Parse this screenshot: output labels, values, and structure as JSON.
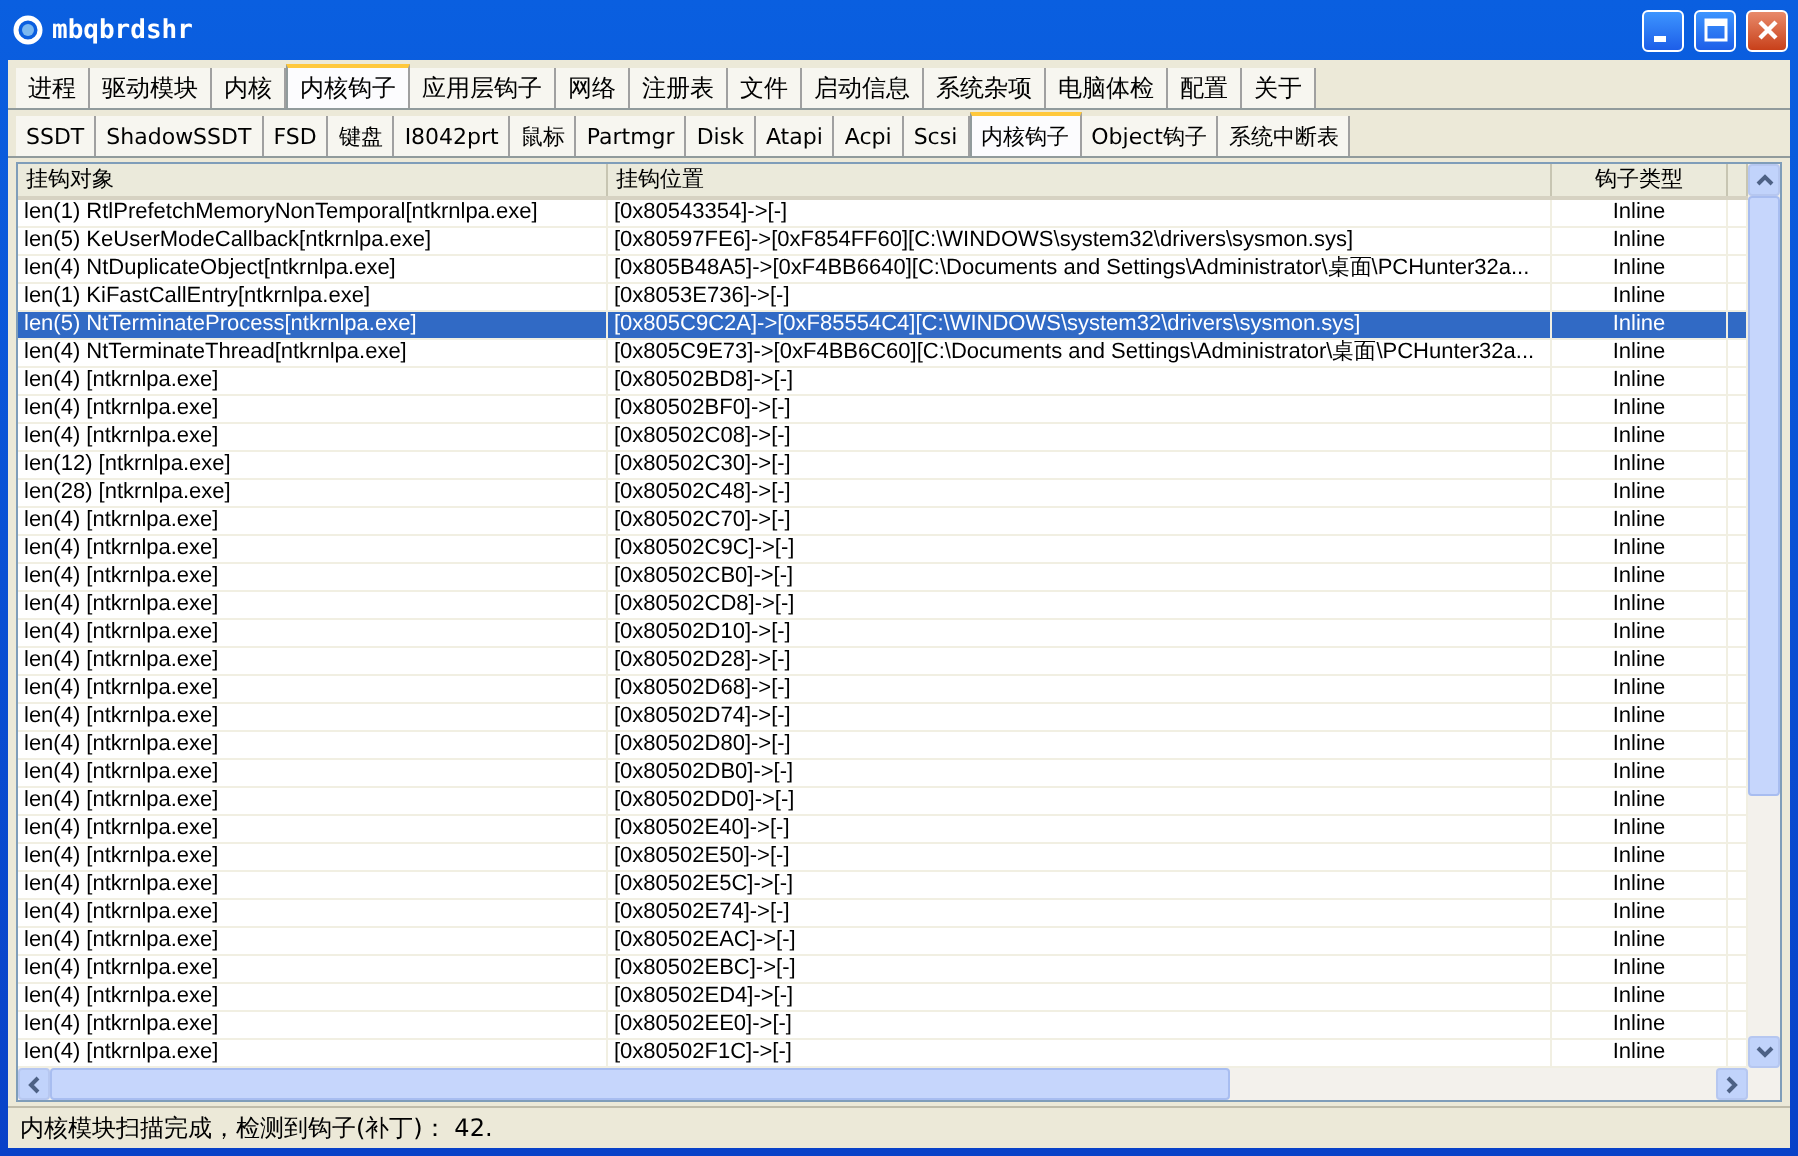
{
  "window": {
    "title": "mbqbrdshr"
  },
  "main_tabs": [
    {
      "label": "进程",
      "selected": false
    },
    {
      "label": "驱动模块",
      "selected": false
    },
    {
      "label": "内核",
      "selected": false
    },
    {
      "label": "内核钩子",
      "selected": true
    },
    {
      "label": "应用层钩子",
      "selected": false
    },
    {
      "label": "网络",
      "selected": false
    },
    {
      "label": "注册表",
      "selected": false
    },
    {
      "label": "文件",
      "selected": false
    },
    {
      "label": "启动信息",
      "selected": false
    },
    {
      "label": "系统杂项",
      "selected": false
    },
    {
      "label": "电脑体检",
      "selected": false
    },
    {
      "label": "配置",
      "selected": false
    },
    {
      "label": "关于",
      "selected": false
    }
  ],
  "sub_tabs": [
    {
      "label": "SSDT",
      "selected": false
    },
    {
      "label": "ShadowSSDT",
      "selected": false
    },
    {
      "label": "FSD",
      "selected": false
    },
    {
      "label": "键盘",
      "selected": false
    },
    {
      "label": "I8042prt",
      "selected": false
    },
    {
      "label": "鼠标",
      "selected": false
    },
    {
      "label": "Partmgr",
      "selected": false
    },
    {
      "label": "Disk",
      "selected": false
    },
    {
      "label": "Atapi",
      "selected": false
    },
    {
      "label": "Acpi",
      "selected": false
    },
    {
      "label": "Scsi",
      "selected": false
    },
    {
      "label": "内核钩子",
      "selected": true
    },
    {
      "label": "Object钩子",
      "selected": false
    },
    {
      "label": "系统中断表",
      "selected": false
    }
  ],
  "table": {
    "columns": [
      "挂钩对象",
      "挂钩位置",
      "钩子类型"
    ],
    "rows": [
      {
        "object": "len(1) RtlPrefetchMemoryNonTemporal[ntkrnlpa.exe]",
        "location": "[0x80543354]->[-]",
        "type": "Inline",
        "selected": false
      },
      {
        "object": "len(5) KeUserModeCallback[ntkrnlpa.exe]",
        "location": "[0x80597FE6]->[0xF854FF60][C:\\WINDOWS\\system32\\drivers\\sysmon.sys]",
        "type": "Inline",
        "selected": false
      },
      {
        "object": "len(4) NtDuplicateObject[ntkrnlpa.exe]",
        "location": "[0x805B48A5]->[0xF4BB6640][C:\\Documents and Settings\\Administrator\\桌面\\PCHunter32a...",
        "type": "Inline",
        "selected": false
      },
      {
        "object": "len(1) KiFastCallEntry[ntkrnlpa.exe]",
        "location": "[0x8053E736]->[-]",
        "type": "Inline",
        "selected": false
      },
      {
        "object": "len(5) NtTerminateProcess[ntkrnlpa.exe]",
        "location": "[0x805C9C2A]->[0xF85554C4][C:\\WINDOWS\\system32\\drivers\\sysmon.sys]",
        "type": "Inline",
        "selected": true
      },
      {
        "object": "len(4) NtTerminateThread[ntkrnlpa.exe]",
        "location": "[0x805C9E73]->[0xF4BB6C60][C:\\Documents and Settings\\Administrator\\桌面\\PCHunter32a...",
        "type": "Inline",
        "selected": false
      },
      {
        "object": "len(4) [ntkrnlpa.exe]",
        "location": "[0x80502BD8]->[-]",
        "type": "Inline",
        "selected": false
      },
      {
        "object": "len(4) [ntkrnlpa.exe]",
        "location": "[0x80502BF0]->[-]",
        "type": "Inline",
        "selected": false
      },
      {
        "object": "len(4) [ntkrnlpa.exe]",
        "location": "[0x80502C08]->[-]",
        "type": "Inline",
        "selected": false
      },
      {
        "object": "len(12) [ntkrnlpa.exe]",
        "location": "[0x80502C30]->[-]",
        "type": "Inline",
        "selected": false
      },
      {
        "object": "len(28) [ntkrnlpa.exe]",
        "location": "[0x80502C48]->[-]",
        "type": "Inline",
        "selected": false
      },
      {
        "object": "len(4) [ntkrnlpa.exe]",
        "location": "[0x80502C70]->[-]",
        "type": "Inline",
        "selected": false
      },
      {
        "object": "len(4) [ntkrnlpa.exe]",
        "location": "[0x80502C9C]->[-]",
        "type": "Inline",
        "selected": false
      },
      {
        "object": "len(4) [ntkrnlpa.exe]",
        "location": "[0x80502CB0]->[-]",
        "type": "Inline",
        "selected": false
      },
      {
        "object": "len(4) [ntkrnlpa.exe]",
        "location": "[0x80502CD8]->[-]",
        "type": "Inline",
        "selected": false
      },
      {
        "object": "len(4) [ntkrnlpa.exe]",
        "location": "[0x80502D10]->[-]",
        "type": "Inline",
        "selected": false
      },
      {
        "object": "len(4) [ntkrnlpa.exe]",
        "location": "[0x80502D28]->[-]",
        "type": "Inline",
        "selected": false
      },
      {
        "object": "len(4) [ntkrnlpa.exe]",
        "location": "[0x80502D68]->[-]",
        "type": "Inline",
        "selected": false
      },
      {
        "object": "len(4) [ntkrnlpa.exe]",
        "location": "[0x80502D74]->[-]",
        "type": "Inline",
        "selected": false
      },
      {
        "object": "len(4) [ntkrnlpa.exe]",
        "location": "[0x80502D80]->[-]",
        "type": "Inline",
        "selected": false
      },
      {
        "object": "len(4) [ntkrnlpa.exe]",
        "location": "[0x80502DB0]->[-]",
        "type": "Inline",
        "selected": false
      },
      {
        "object": "len(4) [ntkrnlpa.exe]",
        "location": "[0x80502DD0]->[-]",
        "type": "Inline",
        "selected": false
      },
      {
        "object": "len(4) [ntkrnlpa.exe]",
        "location": "[0x80502E40]->[-]",
        "type": "Inline",
        "selected": false
      },
      {
        "object": "len(4) [ntkrnlpa.exe]",
        "location": "[0x80502E50]->[-]",
        "type": "Inline",
        "selected": false
      },
      {
        "object": "len(4) [ntkrnlpa.exe]",
        "location": "[0x80502E5C]->[-]",
        "type": "Inline",
        "selected": false
      },
      {
        "object": "len(4) [ntkrnlpa.exe]",
        "location": "[0x80502E74]->[-]",
        "type": "Inline",
        "selected": false
      },
      {
        "object": "len(4) [ntkrnlpa.exe]",
        "location": "[0x80502EAC]->[-]",
        "type": "Inline",
        "selected": false
      },
      {
        "object": "len(4) [ntkrnlpa.exe]",
        "location": "[0x80502EBC]->[-]",
        "type": "Inline",
        "selected": false
      },
      {
        "object": "len(4) [ntkrnlpa.exe]",
        "location": "[0x80502ED4]->[-]",
        "type": "Inline",
        "selected": false
      },
      {
        "object": "len(4) [ntkrnlpa.exe]",
        "location": "[0x80502EE0]->[-]",
        "type": "Inline",
        "selected": false
      },
      {
        "object": "len(4) [ntkrnlpa.exe]",
        "location": "[0x80502F1C]->[-]",
        "type": "Inline",
        "selected": false
      }
    ]
  },
  "status_bar": "内核模块扫描完成，检测到钩子(补丁)： 42."
}
